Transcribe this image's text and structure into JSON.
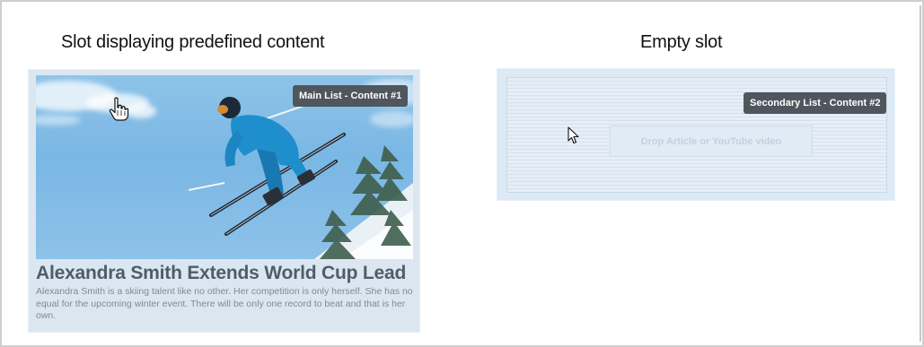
{
  "captions": {
    "left": "Slot displaying predefined content",
    "right": "Empty slot"
  },
  "left_slot": {
    "badge": "Main List - Content #1",
    "title": "Alexandra Smith Extends World Cup Lead",
    "body": "Alexandra Smith is a skiing talent like no other. Her competition is only herself. She has no equal for the upcoming winter event. There will be only one record to beat and that is her own.",
    "cursor_icon": "hand-pointer-icon",
    "image_subject": "skier-jumping-photo"
  },
  "right_slot": {
    "badge": "Secondary List - Content #2",
    "drop_placeholder": "Drop Article or YouTube video",
    "cursor_icon": "arrow-cursor-icon"
  },
  "colors": {
    "badge_bg": "#4f565d",
    "slot_bg": "#dbe6f1",
    "title_text": "#4f5d6b"
  }
}
